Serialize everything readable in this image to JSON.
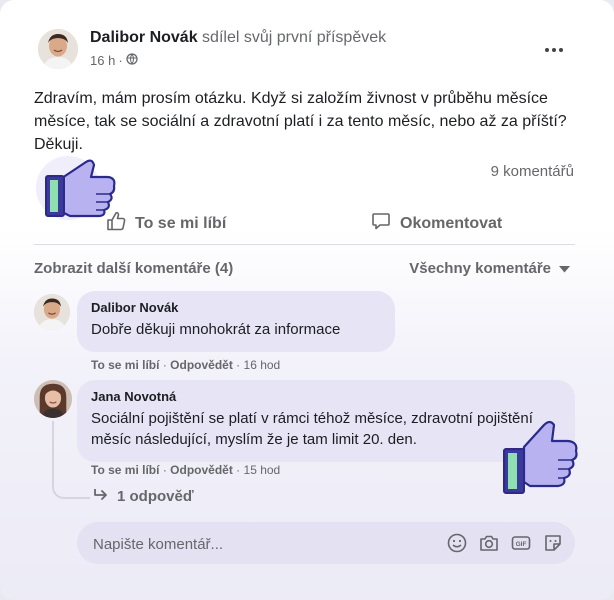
{
  "post": {
    "author": "Dalibor Novák",
    "action": "sdílel svůj první příspěvek",
    "time": "16 h",
    "privacy_separator": "·",
    "text": "Zdravím, mám prosím otázku. Když si založím živnost v průběhu měsíce měsíce, tak se sociální a zdravotní platí i za tento měsíc, nebo až za příští? Děkuji.",
    "comment_count": "9 komentářů"
  },
  "actions": {
    "like": "To se mi líbí",
    "comment": "Okomentovat"
  },
  "comments_header": {
    "more": "Zobrazit další komentáře (4)",
    "filter": "Všechny komentáře"
  },
  "comments": [
    {
      "name": "Dalibor Novák",
      "text": "Dobře děkuji mnohokrát za informace",
      "like": "To se mi líbí",
      "sep": "·",
      "reply": "Odpovědět",
      "time": "16 hod"
    },
    {
      "name": "Jana Novotná",
      "text": "Sociální pojištění se platí v rámci téhož měsíce, zdravotní pojištění měsíc následující, myslím že je tam limit 20. den.",
      "like": "To se mi líbí",
      "sep": "·",
      "reply": "Odpovědět",
      "time": "15 hod"
    }
  ],
  "replies": {
    "label": "1 odpověď"
  },
  "comment_box": {
    "placeholder": "Napište komentář..."
  },
  "icons": [
    "more-options-icon",
    "globe-icon",
    "thumbs-up-icon",
    "comment-icon",
    "caret-down-icon",
    "reply-arrow-icon",
    "emoji-icon",
    "camera-icon",
    "gif-icon",
    "sticker-icon"
  ],
  "colors": {
    "bubble": "#e6e4f5",
    "thumb_fill": "#b5b0f0",
    "thumb_outline": "#2b2a8a",
    "thumb_cuff": "#8ee0b0",
    "text_muted": "#65676b"
  }
}
